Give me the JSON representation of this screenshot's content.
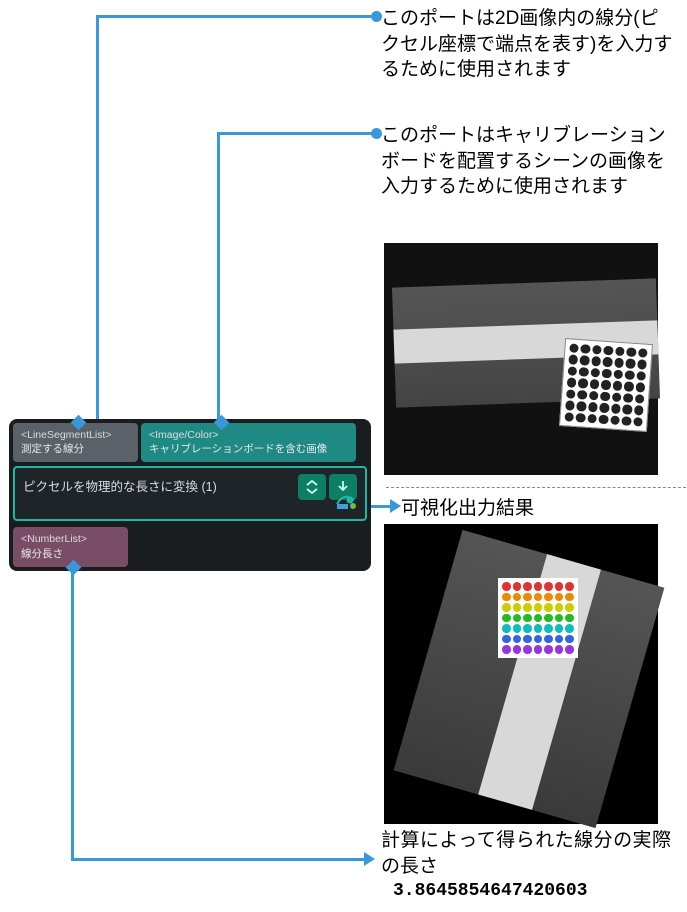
{
  "annotations": {
    "port1": "このポートは2D画像内の線分(ピクセル座標で端点を表す)を入力するために使用されます",
    "port2": "このポートはキャリブレーションボードを配置するシーンの画像を入力するために使用されます",
    "vis": "可視化出力結果",
    "output": "計算によって得られた線分の実際の長さ"
  },
  "node": {
    "inputs": [
      {
        "type": "<LineSegmentList>",
        "label": "測定する線分"
      },
      {
        "type": "<Image/Color>",
        "label": "キャリブレーションボードを含む画像"
      }
    ],
    "title": "ピクセルを物理的な長さに変換 (1)",
    "outputs": [
      {
        "type": "<NumberList>",
        "label": "線分長さ"
      }
    ]
  },
  "result_value": "3.8645854647420603",
  "icons": {
    "expand": "expand-icon",
    "down": "download-icon",
    "eye": "visibility-icon"
  }
}
